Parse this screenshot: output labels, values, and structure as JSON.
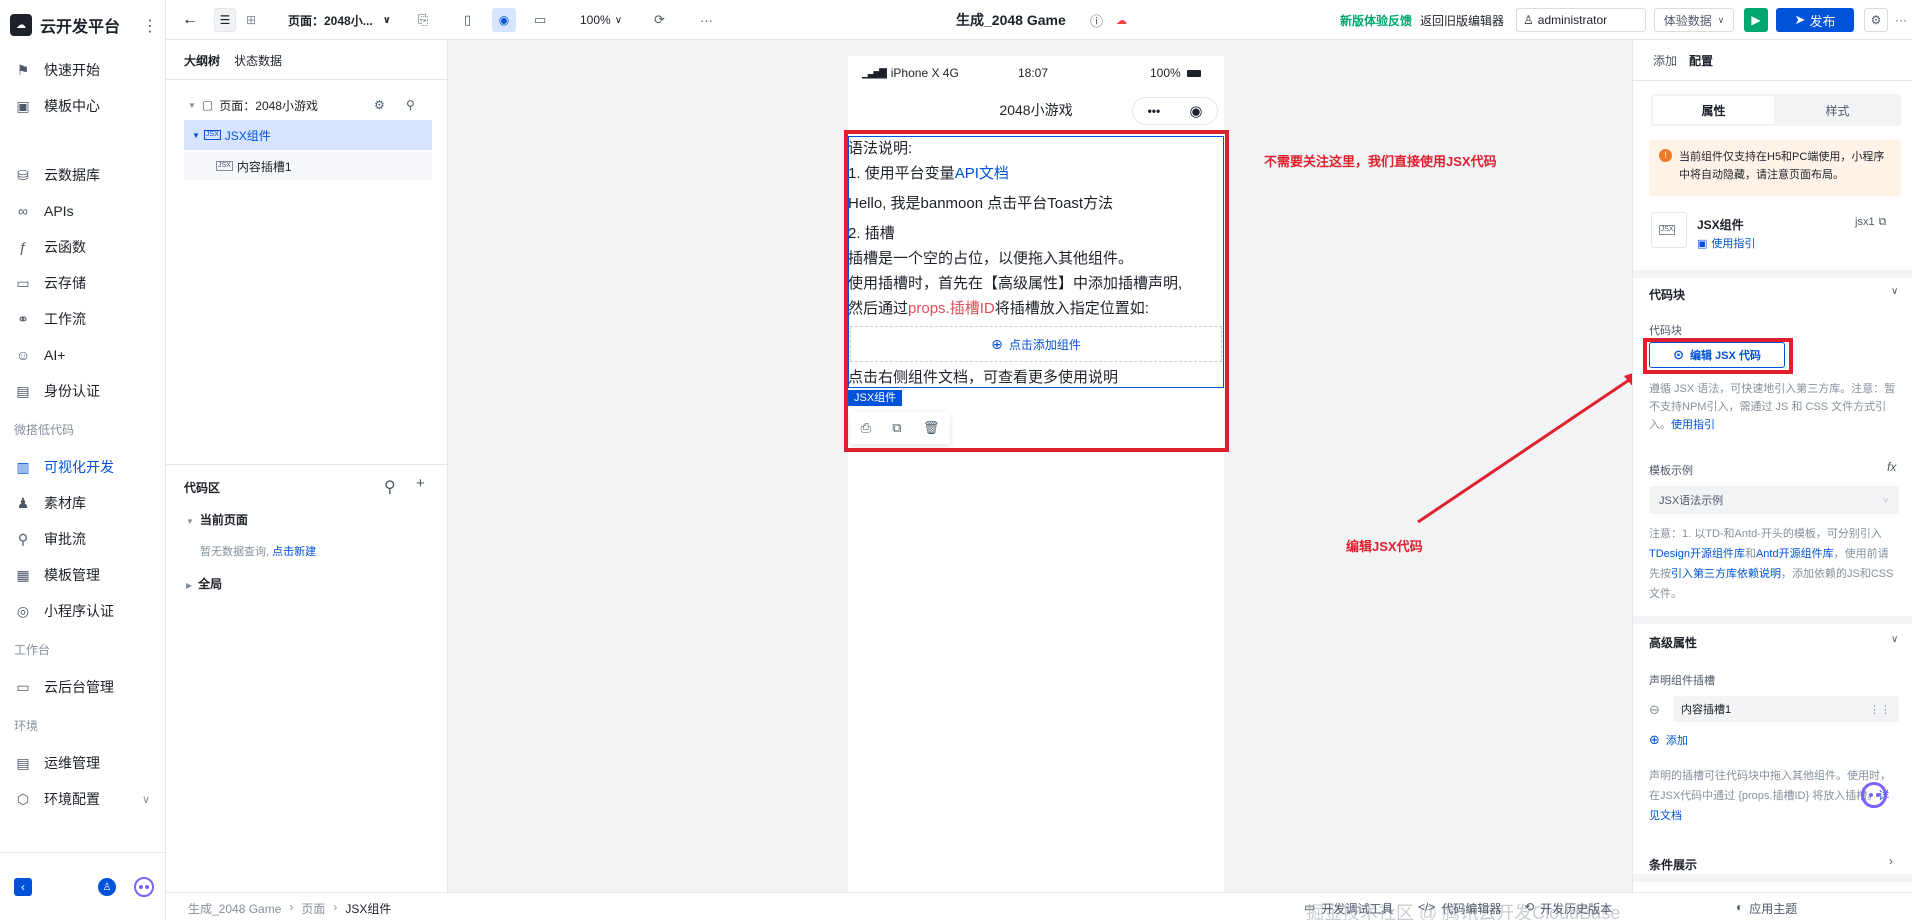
{
  "sidebar": {
    "brand": "云开发平台",
    "items": [
      {
        "label": "快速开始",
        "icon": "flag-icon"
      },
      {
        "label": "模板中心",
        "icon": "template-icon"
      }
    ],
    "group2": [
      {
        "label": "云数据库",
        "icon": "database-icon"
      },
      {
        "label": "APIs",
        "icon": "link-icon"
      },
      {
        "label": "云函数",
        "icon": "function-icon"
      },
      {
        "label": "云存储",
        "icon": "folder-icon"
      },
      {
        "label": "工作流",
        "icon": "workflow-icon"
      },
      {
        "label": "AI+",
        "icon": "robot-icon"
      },
      {
        "label": "身份认证",
        "icon": "id-card-icon"
      }
    ],
    "group_lowcode": "微搭低代码",
    "lowcode": [
      {
        "label": "可视化开发",
        "icon": "visual-dev-icon"
      },
      {
        "label": "素材库",
        "icon": "assets-icon"
      },
      {
        "label": "审批流",
        "icon": "approval-icon"
      },
      {
        "label": "模板管理",
        "icon": "template-manage-icon"
      },
      {
        "label": "小程序认证",
        "icon": "miniprogram-icon"
      }
    ],
    "group_workbench": "工作台",
    "workbench": [
      {
        "label": "云后台管理",
        "icon": "monitor-icon"
      }
    ],
    "group_env": "环境",
    "env": [
      {
        "label": "运维管理",
        "icon": "ops-icon"
      },
      {
        "label": "环境配置",
        "icon": "env-config-icon"
      }
    ]
  },
  "topbar": {
    "page_selector": "页面：2048小...",
    "zoom": "100%",
    "title": "生成_2048 Game",
    "feedback": "新版体验反馈",
    "return_old": "返回旧版编辑器",
    "user": "administrator",
    "data_mode": "体验数据",
    "publish": "发布",
    "more": "···"
  },
  "outline": {
    "tab_tree": "大纲树",
    "tab_state": "状态数据",
    "page_node": "页面：2048小游戏",
    "jsx_node": "JSX组件",
    "slot_node": "内容插槽1",
    "code_title": "代码区",
    "current_page": "当前页面",
    "empty_text": "暂无数据查询,",
    "create_link": "点击新建",
    "global": "全局"
  },
  "phone": {
    "carrier": "iPhone X  4G",
    "time": "18:07",
    "battery": "100%",
    "nav_title": "2048小游戏",
    "line1": "语法说明:",
    "line2_pre": "1. 使用平台变量",
    "line2_link": "API文档",
    "line3": "Hello, 我是banmoon 点击平台Toast方法",
    "line4": "2. 插槽",
    "line5": "插槽是一个空的占位，以便拖入其他组件。",
    "line6": "使用插槽时，首先在【高级属性】中添加插槽声明,",
    "line7_pre": "然后通过",
    "line7_red": "props.插槽ID",
    "line7_post": "将插槽放入指定位置如:",
    "add_component": "点击添加组件",
    "line8": "点击右侧组件文档，可查看更多使用说明",
    "jsx_label": "JSX组件"
  },
  "annotations": {
    "note1": "不需要关注这里，我们直接使用JSX代码",
    "note2": "编辑JSX代码"
  },
  "right": {
    "tab_add": "添加",
    "tab_config": "配置",
    "seg_props": "属性",
    "seg_style": "样式",
    "warning": "当前组件仅支持在H5和PC端使用，小程序中将自动隐藏，请注意页面布局。",
    "comp_name": "JSX组件",
    "comp_id": "jsx1",
    "guide": "使用指引",
    "code_block": "代码块",
    "code_label": "代码块",
    "edit_jsx": "编辑 JSX 代码",
    "code_desc": "遵循 JSX 语法，可快速地引入第三方库。注意：暂不支持NPM引入，需通过 JS 和 CSS 文件方式引入。",
    "code_desc_link": "使用指引",
    "template_label": "模板示例",
    "template_value": "JSX语法示例",
    "note_pre": "注意：1. 以TD-和Antd-开头的模板，可分别引入",
    "note_link1": "TDesign开源组件库",
    "note_mid": "和",
    "note_link2": "Antd开源组件库",
    "note_post1": "，使用前请先按",
    "note_link3": "引入第三方库依赖说明",
    "note_post2": "，添加依赖的JS和CSS文件。",
    "advanced": "高级属性",
    "slot_label": "声明组件插槽",
    "slot_value": "内容插槽1",
    "add": "添加",
    "slot_desc": "声明的插槽可往代码块中拖入其他组件。使用时，在JSX代码中通过 {props.插槽ID} 将放入插槽。",
    "slot_desc_link": "详见文档",
    "conditional": "条件展示"
  },
  "statusbar": {
    "crumb1": "生成_2048 Game",
    "crumb2": "页面",
    "crumb3": "JSX组件",
    "debug": "开发调试工具",
    "code_editor": "代码编辑器",
    "history": "开发历史版本",
    "theme": "应用主题"
  },
  "watermark": "掘金技术社区 @ 腾讯云开发CloudBase",
  "colors": {
    "primary": "#0052d9",
    "accent_green": "#00a870",
    "annotation_red": "#e0202e"
  }
}
